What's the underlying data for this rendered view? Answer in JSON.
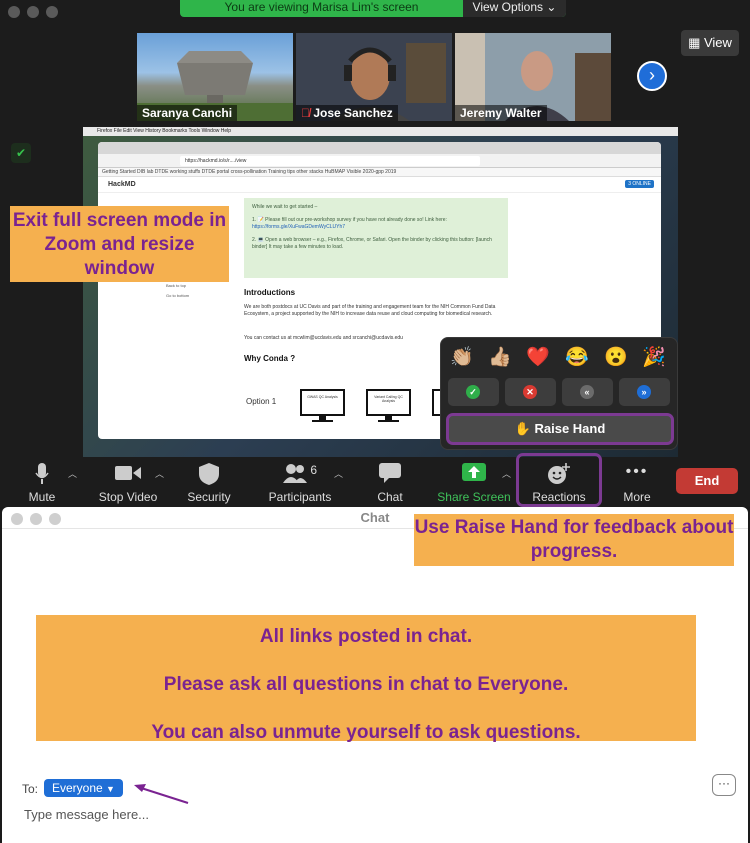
{
  "meeting": {
    "viewing_banner": "You are viewing Marisa Lim's screen",
    "view_options": "View Options",
    "view_button": "View",
    "participants": [
      {
        "name": "Saranya Canchi",
        "muted": false
      },
      {
        "name": "Jose Sanchez",
        "muted": true
      },
      {
        "name": "Jeremy Walter",
        "muted": false
      }
    ]
  },
  "shared_screen": {
    "mac_menu": "Firefox   File   Edit   View   History   Bookmarks   Tools   Window   Help",
    "url": "https://hackmd.io/s/r..../view",
    "bookmarks": "Getting Started   DIB lab   DTDE working stuffs   DTDE portal   cross-pollination   Training tips   other stacks   HuBMAP Visible   2020-gpp 2019",
    "hackmd_logo": "HackMD",
    "online_badge": "3 ONLINE",
    "wait_intro": "While we wait to get started –",
    "step1": "1. 📝 Please fill out our pre-workshop survey if you have not already done so! Link here:",
    "survey_link": "https://forms.gle/XuFwaGDemWyCLUYh7",
    "step2": "2. 💻 Open a web browser – e.g., Firefox, Chrome, or Safari. Open the binder by clicking this button: [launch binder]  It may take a few minutes to load.",
    "sidebar": [
      "Resources",
      "Expand all",
      "Back to top",
      "Go to bottom"
    ],
    "intro_heading": "Introductions",
    "intro_text": "We are both postdocs at UC Davis and part of the training and engagement team for the NIH Common Fund Data Ecosystem, a project supported by the NIH to increase data reuse and cloud computing for biomedical research.",
    "contact": "You can contact us at mcwlim@ucdavis.edu and srcanchi@ucdavis.edu",
    "why_heading": "Why Conda ?",
    "option1": "Option 1",
    "monitors": [
      "GWAS QC Analysis",
      "Variant Calling QC Analysis"
    ]
  },
  "annotations": {
    "exit_full_screen": "Exit full screen mode in Zoom and resize window",
    "raise_hand_tip": "Use Raise Hand for feedback about progress.",
    "chat_notes": [
      "All links posted in chat.",
      "Please ask all questions in chat to Everyone.",
      "You can also unmute yourself to ask questions."
    ]
  },
  "reactions": {
    "emojis": [
      "👏🏼",
      "👍🏼",
      "❤️",
      "😂",
      "😮",
      "🎉"
    ],
    "buttons": [
      {
        "name": "yes-button",
        "glyph": "✓",
        "color": "#2fae4a"
      },
      {
        "name": "no-button",
        "glyph": "✕",
        "color": "#d93a32"
      },
      {
        "name": "slow-down-button",
        "glyph": "«",
        "color": "#6b6b6b"
      },
      {
        "name": "speed-up-button",
        "glyph": "»",
        "color": "#1f6ed6"
      }
    ],
    "raise_hand": "✋ Raise Hand"
  },
  "toolbar": {
    "mute": "Mute",
    "stop_video": "Stop Video",
    "security": "Security",
    "participants": "Participants",
    "participant_count": "6",
    "chat": "Chat",
    "share_screen": "Share Screen",
    "reactions": "Reactions",
    "more": "More",
    "end": "End"
  },
  "chat": {
    "title": "Chat",
    "to_label": "To:",
    "recipient": "Everyone",
    "placeholder": "Type message here..."
  },
  "colors": {
    "annotation_bg": "#f5b04f",
    "annotation_text": "#7a2391",
    "accent_blue": "#1f6ed6",
    "end_red": "#c33a34",
    "share_green": "#2fb54a"
  }
}
